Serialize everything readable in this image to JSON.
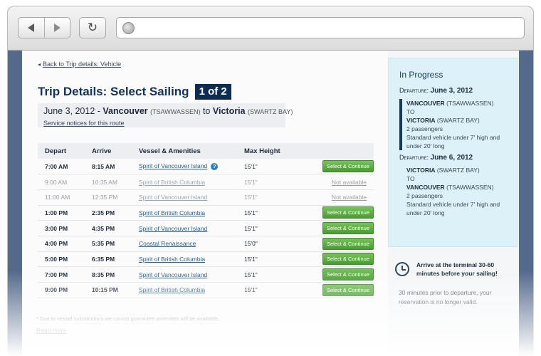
{
  "browser": {
    "back_icon": "arrow-left-icon",
    "forward_icon": "arrow-right-icon",
    "reload_glyph": "↻",
    "url": ""
  },
  "main": {
    "back_link": "Back to Trip details: Vehicle",
    "title": "Trip Details: Select Sailing",
    "step_badge": "1 of 2",
    "route": {
      "date": "June 3, 2012 -",
      "origin": "Vancouver",
      "origin_terminal": "(TSAWWASSEN)",
      "connector": "to",
      "destination": "Victoria",
      "destination_terminal": "(SWARTZ BAY)",
      "service_link": "Service notices for this route"
    },
    "table": {
      "headers": [
        "Depart",
        "Arrive",
        "Vessel & Amenities",
        "Max Height",
        ""
      ],
      "rows": [
        {
          "depart": "7:00 AM",
          "arrive": "8:15 AM",
          "vessel": "Spirit of Vancouver Island",
          "height": "15'1\"",
          "action": "Select & Continue",
          "available": true,
          "info": true
        },
        {
          "depart": "9:00 AM",
          "arrive": "10:35 AM",
          "vessel": "Spirit of British Columbia",
          "height": "15'1\"",
          "action": "Not available",
          "available": false,
          "info": false
        },
        {
          "depart": "11:00 AM",
          "arrive": "12:35 PM",
          "vessel": "Spirit of Vancouver Island",
          "height": "15'1\"",
          "action": "Not available",
          "available": false,
          "info": false
        },
        {
          "depart": "1:00 PM",
          "arrive": "2:35 PM",
          "vessel": "Spirit of British Columbia",
          "height": "15'1\"",
          "action": "Select & Continue",
          "available": true,
          "info": false
        },
        {
          "depart": "3:00 PM",
          "arrive": "4:35 PM",
          "vessel": "Spirit of Vancouver Island",
          "height": "15'1\"",
          "action": "Select & Continue",
          "available": true,
          "info": false
        },
        {
          "depart": "4:00 PM",
          "arrive": "5:35 PM",
          "vessel": "Coastal Renaissance",
          "height": "15'0\"",
          "action": "Select & Continue",
          "available": true,
          "info": false
        },
        {
          "depart": "5:00 PM",
          "arrive": "6:35 PM",
          "vessel": "Spirit of British Columbia",
          "height": "15'1\"",
          "action": "Select & Continue",
          "available": true,
          "info": false
        },
        {
          "depart": "7:00 PM",
          "arrive": "8:35 PM",
          "vessel": "Spirit of Vancouver Island",
          "height": "15'1\"",
          "action": "Select & Continue",
          "available": true,
          "info": false
        },
        {
          "depart": "9:00 PM",
          "arrive": "10:15 PM",
          "vessel": "Spirit of British Columbia",
          "height": "15'1\"",
          "action": "Select & Continue",
          "available": true,
          "info": false
        }
      ]
    },
    "footnote": "* Due to vessel substitutions we cannot guarantee amenities will be available.",
    "read_more": "Read more"
  },
  "sidebar": {
    "progress_title": "In Progress",
    "legs": [
      {
        "dep_label": "Departure:",
        "date": "June 3, 2012",
        "from": "VANCOUVER",
        "from_terminal": "(TSAWWASSEN)",
        "to_word": "TO",
        "to": "VICTORIA",
        "to_terminal": "(SWARTZ BAY)",
        "passengers": "2 passengers",
        "vehicle": "Standard vehicle under 7' high and under 20' long",
        "active": true
      },
      {
        "dep_label": "Departure:",
        "date": "June 6, 2012",
        "from": "VICTORIA",
        "from_terminal": "(SWARTZ BAY)",
        "to_word": "TO",
        "to": "VANCOUVER",
        "to_terminal": "(TSAWWASSEN)",
        "passengers": "2 passengers",
        "vehicle": "Standard vehicle under 7' high and under 20' long",
        "active": false
      }
    ],
    "notice": {
      "icon": "clock-icon",
      "title": "Arrive at the terminal 30-60 minutes before your sailing!",
      "body": "30 minutes prior to departure, your reservation is no longer valid."
    }
  },
  "colors": {
    "brand_navy": "#13335a",
    "button_green": "#4a9a34",
    "sidebar_blue": "#dcf1f8",
    "frame_blue": "#546a8c"
  }
}
